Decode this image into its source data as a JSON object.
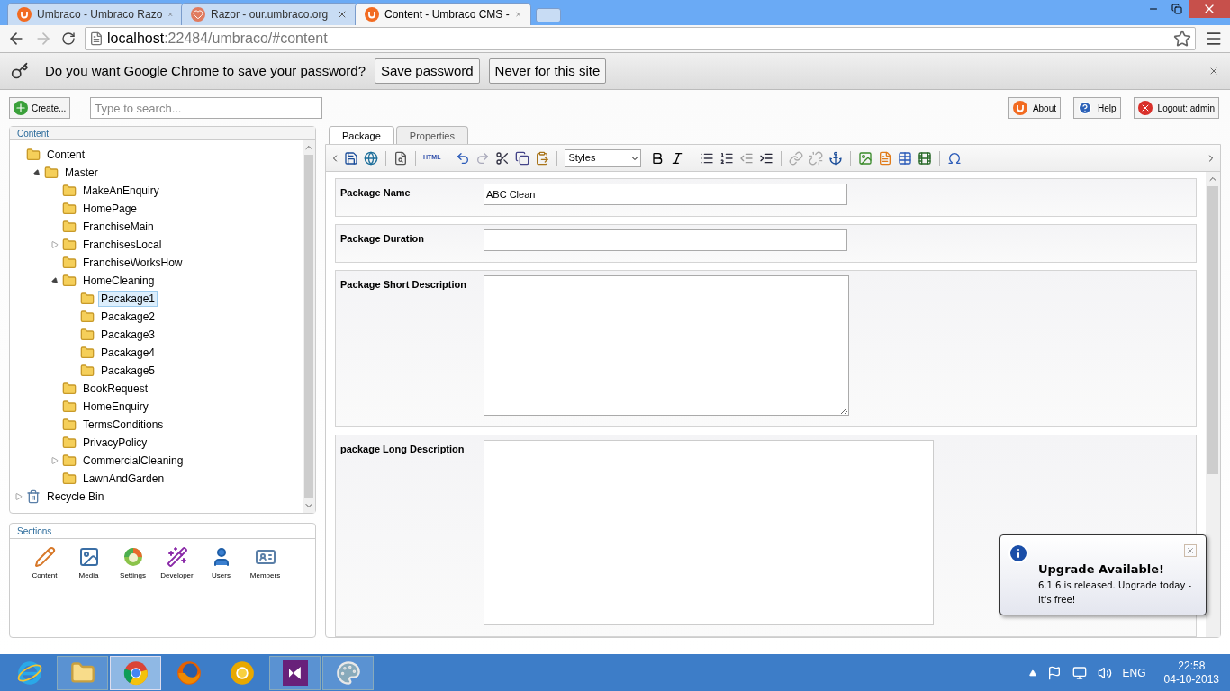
{
  "browser": {
    "tabs": [
      {
        "title": "Umbraco - Umbraco Razo",
        "kind": "umbraco",
        "selected": false
      },
      {
        "title": "Razor - our.umbraco.org",
        "kind": "heart",
        "selected": false
      },
      {
        "title": "Content - Umbraco CMS -",
        "kind": "umbraco",
        "selected": true
      }
    ],
    "address": {
      "host": "localhost",
      "path": ":22484/umbraco/#content"
    },
    "password_bar": {
      "question": "Do you want Google Chrome to save your password?",
      "buttons": [
        "Save password",
        "Never for this site"
      ]
    }
  },
  "app": {
    "create_button": "Create...",
    "search": {
      "placeholder": "Type to search..."
    },
    "header_buttons": [
      {
        "label": "About",
        "kind": "umbraco"
      },
      {
        "label": "Help",
        "kind": "help"
      },
      {
        "label": "Logout: admin",
        "kind": "logout"
      }
    ],
    "tree": {
      "title": "Content",
      "items": [
        {
          "label": "Content",
          "kind": "folder",
          "selected": false,
          "children": [
            {
              "label": "Master",
              "kind": "folder",
              "has_children": true,
              "expanded": true,
              "selected": false,
              "children": [
                {
                  "label": "MakeAnEnquiry",
                  "kind": "folder",
                  "selected": false
                },
                {
                  "label": "HomePage",
                  "kind": "folder",
                  "selected": false
                },
                {
                  "label": "FranchiseMain",
                  "kind": "folder",
                  "selected": false
                },
                {
                  "label": "FranchisesLocal",
                  "kind": "folder",
                  "has_children": true,
                  "expanded": false,
                  "selected": false
                },
                {
                  "label": "FranchiseWorksHow",
                  "kind": "folder",
                  "selected": false
                },
                {
                  "label": "HomeCleaning",
                  "kind": "folder",
                  "has_children": true,
                  "expanded": true,
                  "selected": false,
                  "children": [
                    {
                      "label": "Pacakage1",
                      "kind": "folder",
                      "selected": true
                    },
                    {
                      "label": "Pacakage2",
                      "kind": "folder",
                      "selected": false
                    },
                    {
                      "label": "Pacakage3",
                      "kind": "folder",
                      "selected": false
                    },
                    {
                      "label": "Pacakage4",
                      "kind": "folder",
                      "selected": false
                    },
                    {
                      "label": "Pacakage5",
                      "kind": "folder",
                      "selected": false
                    }
                  ]
                },
                {
                  "label": "BookRequest",
                  "kind": "folder",
                  "selected": false
                },
                {
                  "label": "HomeEnquiry",
                  "kind": "folder",
                  "selected": false
                },
                {
                  "label": "TermsConditions",
                  "kind": "folder",
                  "selected": false
                },
                {
                  "label": "PrivacyPolicy",
                  "kind": "folder",
                  "selected": false
                },
                {
                  "label": "CommercialCleaning",
                  "kind": "folder",
                  "has_children": true,
                  "expanded": false,
                  "selected": false
                },
                {
                  "label": "LawnAndGarden",
                  "kind": "folder",
                  "selected": false
                }
              ]
            }
          ]
        },
        {
          "label": "Recycle Bin",
          "kind": "bin",
          "has_children": true,
          "expanded": false,
          "selected": false
        }
      ]
    },
    "sections": {
      "title": "Sections",
      "items": [
        {
          "label": "Content",
          "kind": "content"
        },
        {
          "label": "Media",
          "kind": "media"
        },
        {
          "label": "Settings",
          "kind": "settings"
        },
        {
          "label": "Developer",
          "kind": "developer"
        },
        {
          "label": "Users",
          "kind": "users"
        },
        {
          "label": "Members",
          "kind": "members"
        }
      ]
    },
    "editor": {
      "tabs": [
        {
          "label": "Package",
          "selected": true
        },
        {
          "label": "Properties",
          "selected": false
        }
      ],
      "html_button": "HTML",
      "styles_select": "Styles",
      "fields": [
        {
          "label": "Package Name",
          "kind": "text",
          "value": "ABC Clean"
        },
        {
          "label": "Package Duration",
          "kind": "text"
        },
        {
          "label": "Package Short Description",
          "kind": "textarea"
        },
        {
          "label": "package Long Description",
          "kind": "richtext"
        }
      ]
    },
    "notification": {
      "title": "Upgrade Available!",
      "message": "6.1.6 is released. Upgrade today - it's free!"
    }
  },
  "taskbar": {
    "apps": [
      {
        "kind": "ie",
        "open": false,
        "selected": false
      },
      {
        "kind": "explorer",
        "open": true,
        "selected": false
      },
      {
        "kind": "chrome",
        "open": true,
        "selected": true
      },
      {
        "kind": "firefox",
        "open": false,
        "selected": false
      },
      {
        "kind": "canary",
        "open": false,
        "selected": false
      },
      {
        "kind": "vs",
        "open": true,
        "selected": false
      },
      {
        "kind": "paint",
        "open": true,
        "selected": false
      }
    ],
    "language": "ENG",
    "time": "22:58",
    "date": "04-10-2013"
  }
}
